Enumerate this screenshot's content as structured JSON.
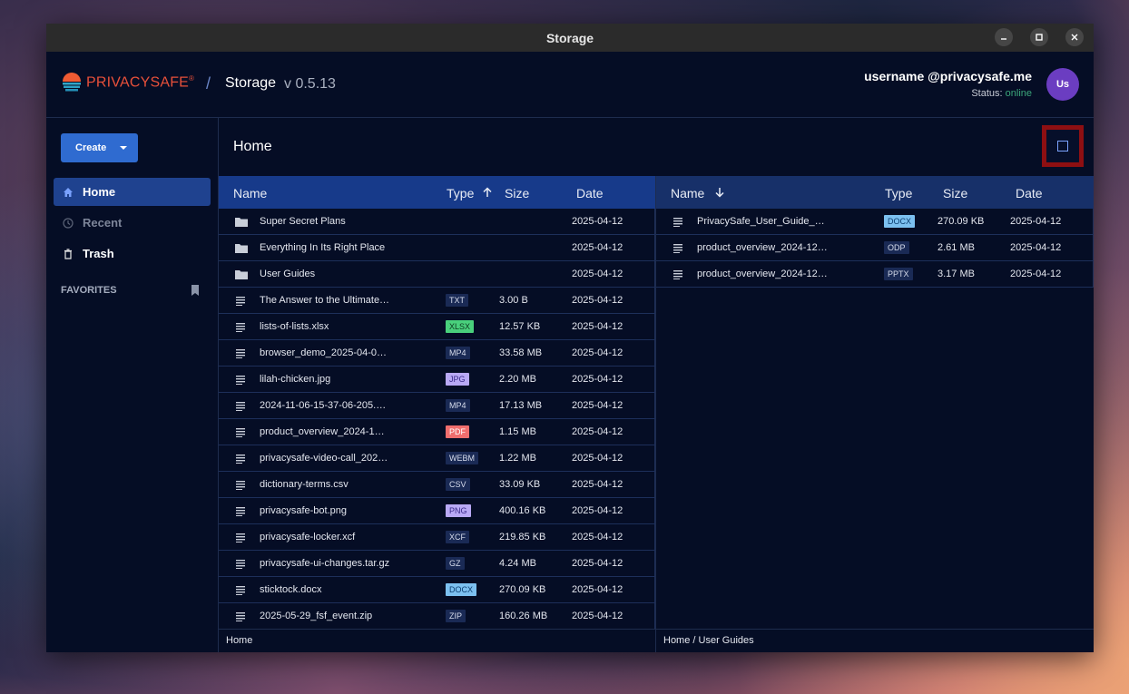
{
  "window": {
    "title": "Storage"
  },
  "app": {
    "brand": "PRIVACYSAFE",
    "brand_mark": "®",
    "separator": "/",
    "name": "Storage",
    "version": "v 0.5.13"
  },
  "user": {
    "name": "username @privacysafe.me",
    "status_label": "Status:",
    "status_value": "online",
    "avatar_initials": "Us"
  },
  "sidebar": {
    "create_label": "Create",
    "items": [
      {
        "label": "Home",
        "icon": "home-icon",
        "active": true
      },
      {
        "label": "Recent",
        "icon": "clock-icon",
        "active": false
      },
      {
        "label": "Trash",
        "icon": "trash-icon",
        "active": false
      }
    ],
    "favorites_label": "FAVORITES"
  },
  "main": {
    "title": "Home"
  },
  "left_pane": {
    "headers": {
      "name": "Name",
      "type": "Type",
      "size": "Size",
      "date": "Date"
    },
    "sort": "type-ascending",
    "footer": "Home",
    "rows": [
      {
        "name": "Super Secret Plans",
        "kind": "folder",
        "type": "",
        "size": "",
        "date": "2025-04-12"
      },
      {
        "name": "Everything In Its Right Place",
        "kind": "folder",
        "type": "",
        "size": "",
        "date": "2025-04-12"
      },
      {
        "name": "User Guides",
        "kind": "folder",
        "type": "",
        "size": "",
        "date": "2025-04-12"
      },
      {
        "name": "The Answer to the Ultimate…",
        "kind": "file",
        "type": "TXT",
        "size": "3.00 B",
        "date": "2025-04-12"
      },
      {
        "name": "lists-of-lists.xlsx",
        "kind": "file",
        "type": "XLSX",
        "size": "12.57 KB",
        "date": "2025-04-12"
      },
      {
        "name": "browser_demo_2025-04-0…",
        "kind": "file",
        "type": "MP4",
        "size": "33.58 MB",
        "date": "2025-04-12"
      },
      {
        "name": "lilah-chicken.jpg",
        "kind": "file",
        "type": "JPG",
        "size": "2.20 MB",
        "date": "2025-04-12"
      },
      {
        "name": "2024-11-06-15-37-06-205.…",
        "kind": "file",
        "type": "MP4",
        "size": "17.13 MB",
        "date": "2025-04-12"
      },
      {
        "name": "product_overview_2024-1…",
        "kind": "file",
        "type": "PDF",
        "size": "1.15 MB",
        "date": "2025-04-12"
      },
      {
        "name": "privacysafe-video-call_202…",
        "kind": "file",
        "type": "WEBM",
        "size": "1.22 MB",
        "date": "2025-04-12"
      },
      {
        "name": "dictionary-terms.csv",
        "kind": "file",
        "type": "CSV",
        "size": "33.09 KB",
        "date": "2025-04-12"
      },
      {
        "name": "privacysafe-bot.png",
        "kind": "file",
        "type": "PNG",
        "size": "400.16 KB",
        "date": "2025-04-12"
      },
      {
        "name": "privacysafe-locker.xcf",
        "kind": "file",
        "type": "XCF",
        "size": "219.85 KB",
        "date": "2025-04-12"
      },
      {
        "name": "privacysafe-ui-changes.tar.gz",
        "kind": "file",
        "type": "GZ",
        "size": "4.24 MB",
        "date": "2025-04-12"
      },
      {
        "name": "sticktock.docx",
        "kind": "file",
        "type": "DOCX",
        "size": "270.09 KB",
        "date": "2025-04-12"
      },
      {
        "name": "2025-05-29_fsf_event.zip",
        "kind": "file",
        "type": "ZIP",
        "size": "160.26 MB",
        "date": "2025-04-12"
      }
    ]
  },
  "right_pane": {
    "headers": {
      "name": "Name",
      "type": "Type",
      "size": "Size",
      "date": "Date"
    },
    "sort": "name-descending",
    "footer": "Home / User Guides",
    "rows": [
      {
        "name": "PrivacySafe_User_Guide_…",
        "kind": "file",
        "type": "DOCX",
        "size": "270.09 KB",
        "date": "2025-04-12"
      },
      {
        "name": "product_overview_2024-12…",
        "kind": "file",
        "type": "ODP",
        "size": "2.61 MB",
        "date": "2025-04-12"
      },
      {
        "name": "product_overview_2024-12…",
        "kind": "file",
        "type": "PPTX",
        "size": "3.17 MB",
        "date": "2025-04-12"
      }
    ]
  },
  "type_colors": {
    "XLSX": {
      "bg": "#49d07c",
      "fg": "#0c3a20"
    },
    "JPG": {
      "bg": "#b9a9f5",
      "fg": "#3b2a8a"
    },
    "PNG": {
      "bg": "#b9a9f5",
      "fg": "#3b2a8a"
    },
    "PDF": {
      "bg": "#f06e6e",
      "fg": "#ffffff"
    },
    "DOCX": {
      "bg": "#7cc0f0",
      "fg": "#0b3e70"
    },
    "default": {
      "bg": "#1a2a55",
      "fg": "#d6dcec"
    }
  }
}
